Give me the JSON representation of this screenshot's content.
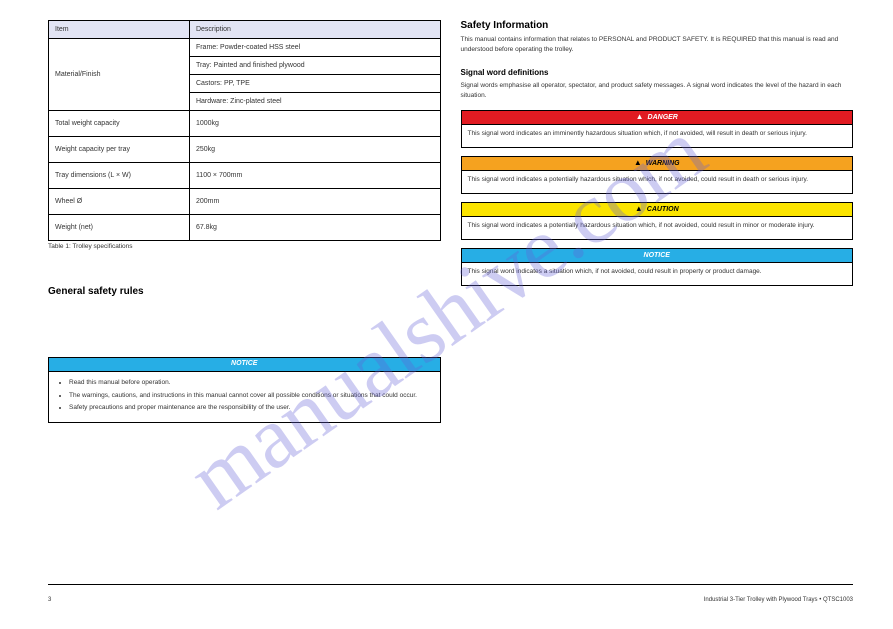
{
  "watermark": "manualshive.com",
  "spec": {
    "headers": [
      "Item",
      "Description"
    ],
    "rows": [
      {
        "label": "Material/Finish",
        "values": [
          "Frame: Powder-coated HSS steel",
          "Tray: Painted and finished plywood",
          "Castors: PP, TPE",
          "Hardware: Zinc-plated steel"
        ],
        "rowspan": 4
      },
      {
        "label": "Total weight capacity",
        "values": [
          "1000kg"
        ],
        "tall": true
      },
      {
        "label": "Weight capacity per tray",
        "values": [
          "250kg"
        ],
        "tall": true
      },
      {
        "label": "Tray dimensions (L × W)",
        "values": [
          "1100 × 700mm"
        ],
        "tall": true
      },
      {
        "label": "Wheel Ø",
        "values": [
          "200mm"
        ],
        "tall": true
      },
      {
        "label": "Weight (net)",
        "values": [
          "67.8kg"
        ],
        "tall": true
      }
    ],
    "caption": "Table 1: Trolley specifications"
  },
  "left_section_title": "General safety rules",
  "notice": {
    "head": "NOTICE",
    "items": [
      "Read this manual before operation.",
      "The warnings, cautions, and instructions in this manual cannot cover all possible conditions or situations that could occur.",
      "Safety precautions and proper maintenance are the responsibility of the user."
    ]
  },
  "right": {
    "title": "Safety Information",
    "intro": "This manual contains information that relates to PERSONAL and PRODUCT SAFETY. It is REQUIRED that this manual is read and understood before operating the trolley.",
    "signal_heading": "Signal word definitions",
    "signal_para": "Signal words emphasise all operator, spectator, and product safety messages. A signal word indicates the level of the hazard in each situation.",
    "signals": [
      {
        "cls": "danger",
        "tri": "red",
        "head": "DANGER",
        "desc": "This signal word indicates an imminently hazardous situation which, if not avoided, will result in death or serious injury."
      },
      {
        "cls": "warning",
        "tri": "blk",
        "head": "WARNING",
        "desc": "This signal word indicates a potentially hazardous situation which, if not avoided, could result in death or serious injury."
      },
      {
        "cls": "caution",
        "tri": "blk",
        "head": "CAUTION",
        "desc": "This signal word indicates a potentially hazardous situation which, if not avoided, could result in minor or moderate injury."
      },
      {
        "cls": "notice",
        "tri": "",
        "head": "NOTICE",
        "desc": "This signal word indicates a situation which, if not avoided, could result in property or product damage."
      }
    ]
  },
  "footer": {
    "page": "3",
    "title": "Industrial 3-Tier Trolley with Plywood Trays • QTSC1003"
  }
}
